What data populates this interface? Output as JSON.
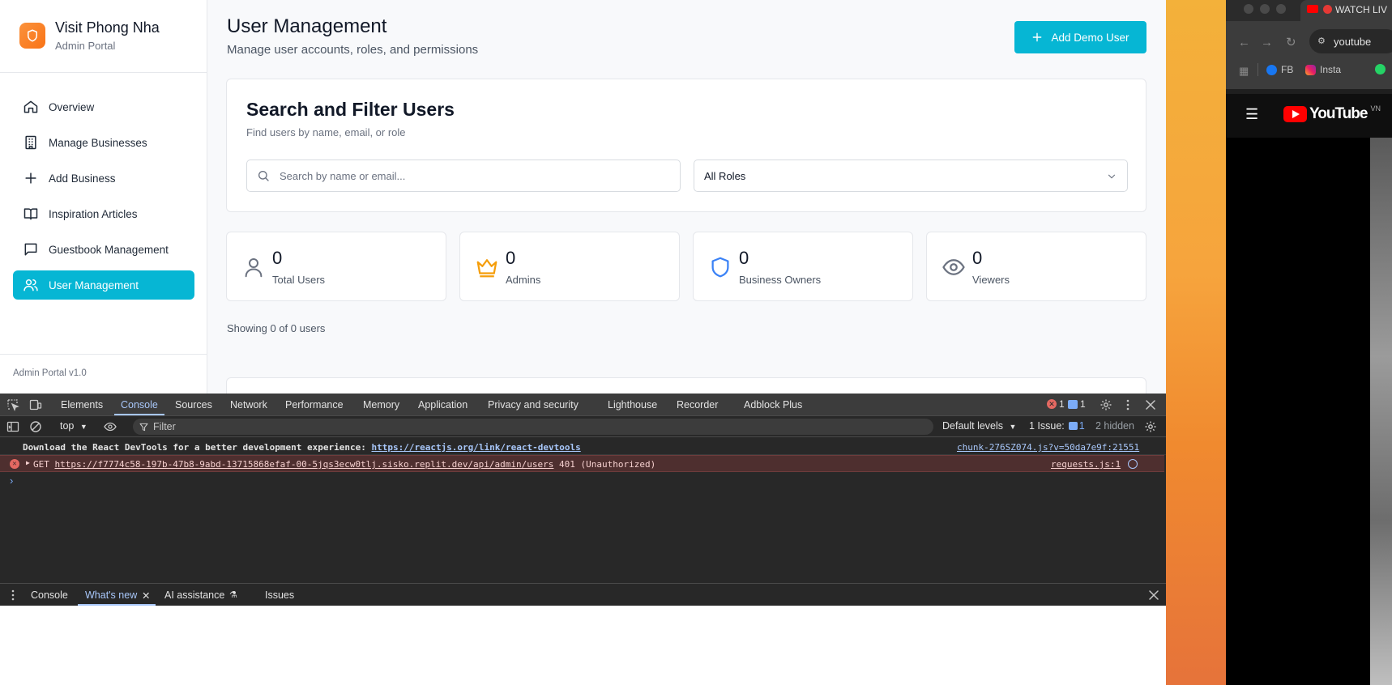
{
  "app": {
    "brand_title": "Visit Phong Nha",
    "brand_subtitle": "Admin Portal",
    "nav": [
      {
        "label": "Overview",
        "icon": "home-icon"
      },
      {
        "label": "Manage Businesses",
        "icon": "building-icon"
      },
      {
        "label": "Add Business",
        "icon": "plus-icon"
      },
      {
        "label": "Inspiration Articles",
        "icon": "book-icon"
      },
      {
        "label": "Guestbook Management",
        "icon": "message-icon"
      },
      {
        "label": "User Management",
        "icon": "users-icon",
        "active": true
      }
    ],
    "footer": "Admin Portal v1.0",
    "accent": "#06b6d4"
  },
  "main": {
    "title": "User Management",
    "subtitle": "Manage user accounts, roles, and permissions",
    "add_button": "Add Demo User",
    "search_card": {
      "title": "Search and Filter Users",
      "subtitle": "Find users by name, email, or role",
      "search_placeholder": "Search by name or email...",
      "role_value": "All Roles"
    },
    "stats": [
      {
        "value": "0",
        "label": "Total Users",
        "icon": "user-icon"
      },
      {
        "value": "0",
        "label": "Admins",
        "icon": "crown-icon"
      },
      {
        "value": "0",
        "label": "Business Owners",
        "icon": "shield-icon"
      },
      {
        "value": "0",
        "label": "Viewers",
        "icon": "eye-icon"
      }
    ],
    "showing": "Showing 0 of 0 users"
  },
  "devtools": {
    "tabs": [
      "Elements",
      "Console",
      "Sources",
      "Network",
      "Performance",
      "Memory",
      "Application",
      "Privacy and security",
      "Lighthouse",
      "Recorder",
      "Adblock Plus"
    ],
    "active_tab": "Console",
    "error_count": "1",
    "message_count": "1",
    "context": "top",
    "filter_placeholder": "Filter",
    "levels": "Default levels",
    "issues": "1 Issue:",
    "issues_count": "1",
    "hidden": "2 hidden",
    "log1_text": "Download the React DevTools for a better development experience: ",
    "log1_link": "https://reactjs.org/link/react-devtools",
    "log1_source": "chunk-276SZ074.js?v=50da7e9f:21551",
    "log2_method": "GET",
    "log2_url": "https://f7774c58-197b-47b8-9abd-13715868efaf-00-5jqs3ecw0tlj.sisko.replit.dev/api/admin/users",
    "log2_status": "401 (Unauthorized)",
    "log2_source": "requests.js:1",
    "prompt": "›",
    "bottom_tabs": [
      "Console",
      "What's new",
      "AI assistance",
      "Issues"
    ],
    "bottom_active": "What's new"
  },
  "browser": {
    "tab_title": "WATCH LIV",
    "address": "youtube",
    "bookmark_fb": "FB",
    "bookmark_insta": "Insta",
    "yt_logo": "YouTube",
    "yt_region": "VN"
  }
}
